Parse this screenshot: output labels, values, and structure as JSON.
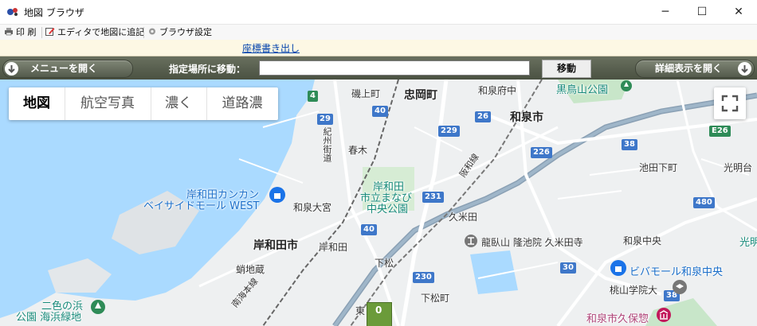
{
  "window": {
    "title": "地図 ブラウザ",
    "minimize": "─",
    "maximize": "☐",
    "close": "✕"
  },
  "toolbar": {
    "print": "印 刷",
    "add_to_editor": "エディタで地図に追記",
    "browser_settings": "ブラウザ設定"
  },
  "linkbar": {
    "export_coords": "座標書き出し"
  },
  "navbar": {
    "open_menu": "メニューを開く",
    "goto_label": "指定場所に移動：",
    "goto_value": "",
    "move_button": "移動",
    "open_details": "詳細表示を開く"
  },
  "map": {
    "map_types": [
      "地図",
      "航空写真",
      "濃く",
      "道路濃"
    ],
    "active_map_type": "地図",
    "places": {
      "isokami": "磯上町",
      "tadaoka": "忠岡町",
      "izumi_fuchu": "和泉府中",
      "kuroto": "黒鳥山公園",
      "izumi_city": "和泉市",
      "kishiwada_kankan_1": "岸和田カンカン",
      "kishiwada_kankan_2": "ベイサイドモール WEST",
      "kishu_road": "紀州街道",
      "haruki": "春木",
      "manabi_1": "岸和田",
      "manabi_2": "市立まなび",
      "manabi_3": "中央公園",
      "hanwa_line": "阪和線",
      "izumi_omiya": "和泉大宮",
      "kumeda": "久米田",
      "kishiwada_city": "岸和田市",
      "kishiwada": "岸和田",
      "ryugai": "龍臥山 隆池院 久米田寺",
      "shimomatsu": "下松",
      "izumi_chuo": "和泉中央",
      "bivi_1": "ビバモール和泉中央",
      "momoyama": "桃山学院大",
      "kaichizo": "蛸地蔵",
      "nankai_line": "南海本線",
      "shimomatsu_cho": "下松町",
      "nishiki_1": "二色の浜",
      "nishiki_2": "公園 海浜緑地",
      "higashi": "東",
      "izumi_museum": "和泉市久保惣",
      "ikedashimo": "池田下町",
      "komyodai": "光明台",
      "komyo_partial": "光明"
    },
    "routes": [
      "4",
      "40",
      "29",
      "229",
      "26",
      "226",
      "38",
      "231",
      "480",
      "40",
      "30",
      "230",
      "E26",
      "38"
    ],
    "pegman_value": "0"
  },
  "colors": {
    "nav_bg": "#5a6150",
    "water": "#aadaff",
    "park": "#c8e6c9"
  }
}
